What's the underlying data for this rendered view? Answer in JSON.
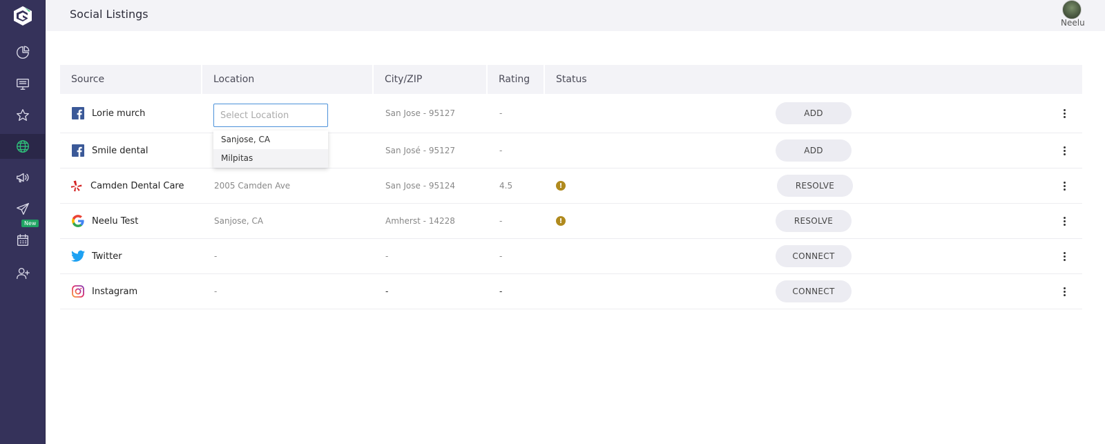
{
  "header": {
    "title": "Social Listings",
    "user_name": "Neelu"
  },
  "sidebar": {
    "items": [
      {
        "name": "dashboard",
        "icon": "pie-chart-icon"
      },
      {
        "name": "monitor",
        "icon": "monitor-icon"
      },
      {
        "name": "reviews",
        "icon": "star-icon"
      },
      {
        "name": "listings",
        "icon": "globe-icon",
        "active": true
      },
      {
        "name": "campaigns",
        "icon": "megaphone-icon"
      },
      {
        "name": "send",
        "icon": "send-icon"
      },
      {
        "name": "calendar",
        "icon": "calendar-icon",
        "badge": "New"
      },
      {
        "name": "add-user",
        "icon": "add-user-icon"
      }
    ]
  },
  "table": {
    "columns": [
      "Source",
      "Location",
      "City/ZIP",
      "Rating",
      "Status"
    ],
    "rows": [
      {
        "source": "Lorie murch",
        "source_icon": "facebook-icon",
        "location": "",
        "city_zip": "San Jose - 95127",
        "rating": "-",
        "status_warning": false,
        "action": "ADD"
      },
      {
        "source": "Smile dental",
        "source_icon": "facebook-icon",
        "location": "",
        "city_zip": "San José - 95127",
        "rating": "-",
        "status_warning": false,
        "action": "ADD"
      },
      {
        "source": "Camden Dental Care",
        "source_icon": "yelp-icon",
        "location": "2005 Camden Ave",
        "city_zip": "San Jose - 95124",
        "rating": "4.5",
        "status_warning": true,
        "action": "RESOLVE"
      },
      {
        "source": "Neelu Test",
        "source_icon": "google-icon",
        "location": "Sanjose, CA",
        "city_zip": "Amherst - 14228",
        "rating": "-",
        "status_warning": true,
        "action": "RESOLVE"
      },
      {
        "source": "Twitter",
        "source_icon": "twitter-icon",
        "location": "-",
        "city_zip": "-",
        "rating": "-",
        "status_warning": false,
        "action": "CONNECT"
      },
      {
        "source": "Instagram",
        "source_icon": "instagram-icon",
        "location": "-",
        "city_zip": "-",
        "rating": "-",
        "status_warning": false,
        "action": "CONNECT"
      }
    ]
  },
  "location_select": {
    "placeholder": "Select Location",
    "options": [
      "Sanjose, CA",
      "Milpitas"
    ]
  },
  "colors": {
    "sidebar": "#35325a",
    "accent": "#2fbf7a",
    "warning": "#b08a1e",
    "input_focus": "#4a90d9"
  }
}
